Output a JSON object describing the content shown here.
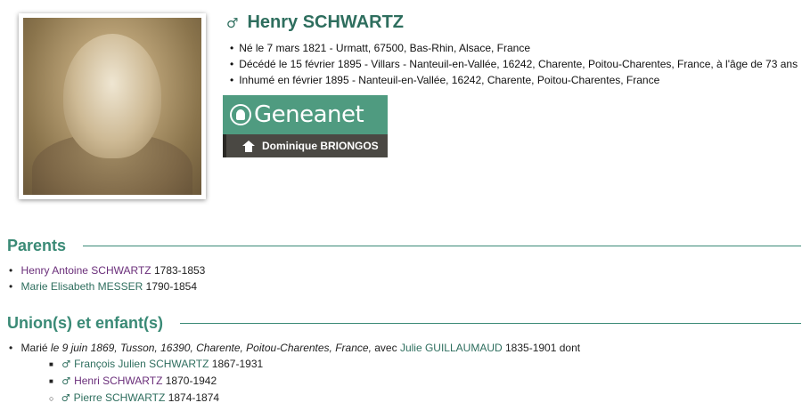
{
  "person": {
    "sex_symbol": "♂",
    "name": "Henry SCHWARTZ",
    "facts": [
      "Né le 7 mars 1821 - Urmatt, 67500, Bas-Rhin, Alsace, France",
      "Décédé le 15 février 1895 - Villars - Nanteuil-en-Vallée, 16242, Charente, Poitou-Charentes, France, à l'âge de 73 ans",
      "Inhumé en février 1895 - Nanteuil-en-Vallée, 16242, Charente, Poitou-Charentes, France"
    ]
  },
  "badge": {
    "brand": "Geneanet",
    "owner": "Dominique BRIONGOS"
  },
  "parents": {
    "title": "Parents",
    "items": [
      {
        "first": "Henry Antoine",
        "last": "SCHWARTZ",
        "dates": "1783-1853"
      },
      {
        "first": "Marie Elisabeth",
        "last": "MESSER",
        "dates": "1790-1854"
      }
    ]
  },
  "unions": {
    "title": "Union(s) et enfant(s)",
    "marriage": {
      "prefix": "Marié",
      "details": "le 9 juin 1869, Tusson, 16390, Charente, Poitou-Charentes, France,",
      "with": "avec",
      "spouse": "Julie GUILLAUMAUD",
      "spouse_dates": "1835-1901 dont"
    },
    "children": [
      {
        "sex_symbol": "♂",
        "name": "François Julien SCHWARTZ",
        "dates": "1867-1931"
      },
      {
        "sex_symbol": "♂",
        "name": "Henri SCHWARTZ",
        "dates": "1870-1942"
      },
      {
        "sex_symbol": "♂",
        "name": "Pierre SCHWARTZ",
        "dates": "1874-1874"
      }
    ]
  },
  "colors": {
    "accent": "#2e6e5e",
    "section": "#3a8a76",
    "link_visited": "#6a2e7a",
    "badge_green": "#4f9b80",
    "badge_dark": "#4a4843"
  }
}
